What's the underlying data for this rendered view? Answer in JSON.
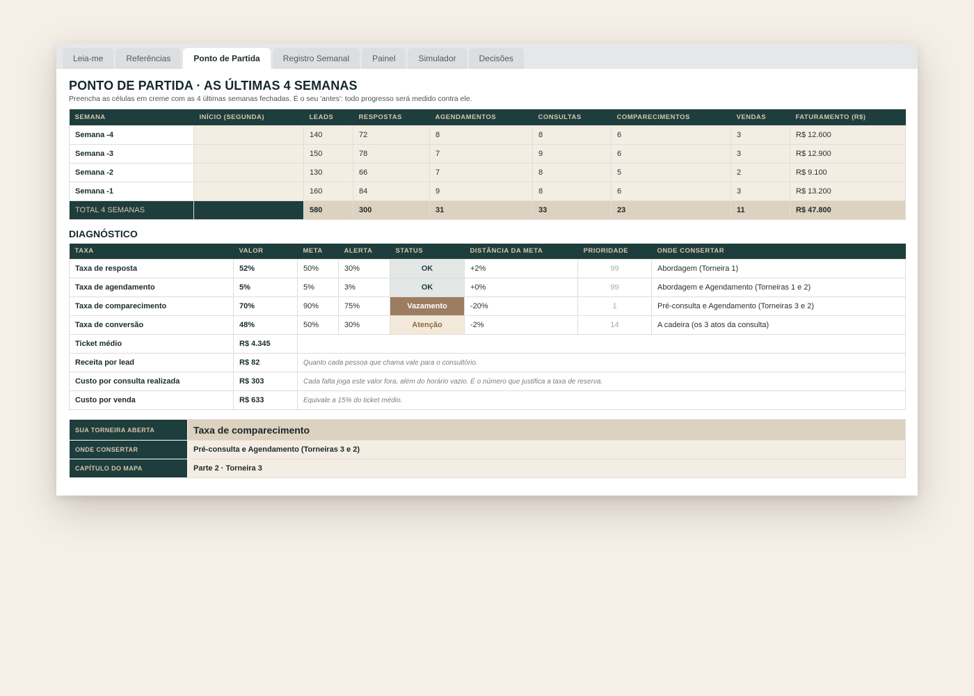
{
  "tabs": [
    {
      "label": "Leia-me",
      "active": false
    },
    {
      "label": "Referências",
      "active": false
    },
    {
      "label": "Ponto de Partida",
      "active": true
    },
    {
      "label": "Registro Semanal",
      "active": false
    },
    {
      "label": "Painel",
      "active": false
    },
    {
      "label": "Simulador",
      "active": false
    },
    {
      "label": "Decisões",
      "active": false
    }
  ],
  "page": {
    "title": "PONTO DE PARTIDA · AS ÚLTIMAS 4 SEMANAS",
    "subtitle": "Preencha as células em creme com as 4 últimas semanas fechadas. É o seu 'antes': todo progresso será medido contra ele."
  },
  "weeks": {
    "headers": [
      "SEMANA",
      "INÍCIO (SEGUNDA)",
      "LEADS",
      "RESPOSTAS",
      "AGENDAMENTOS",
      "CONSULTAS",
      "COMPARECIMENTOS",
      "VENDAS",
      "FATURAMENTO (R$)"
    ],
    "rows": [
      {
        "label": "Semana -4",
        "start": "",
        "leads": "140",
        "respostas": "72",
        "agendamentos": "8",
        "consultas": "8",
        "comparecimentos": "6",
        "vendas": "3",
        "faturamento": "R$ 12.600"
      },
      {
        "label": "Semana -3",
        "start": "",
        "leads": "150",
        "respostas": "78",
        "agendamentos": "7",
        "consultas": "9",
        "comparecimentos": "6",
        "vendas": "3",
        "faturamento": "R$ 12.900"
      },
      {
        "label": "Semana -2",
        "start": "",
        "leads": "130",
        "respostas": "66",
        "agendamentos": "7",
        "consultas": "8",
        "comparecimentos": "5",
        "vendas": "2",
        "faturamento": "R$ 9.100"
      },
      {
        "label": "Semana -1",
        "start": "",
        "leads": "160",
        "respostas": "84",
        "agendamentos": "9",
        "consultas": "8",
        "comparecimentos": "6",
        "vendas": "3",
        "faturamento": "R$ 13.200"
      }
    ],
    "total": {
      "label": "TOTAL 4 SEMANAS",
      "leads": "580",
      "respostas": "300",
      "agendamentos": "31",
      "consultas": "33",
      "comparecimentos": "23",
      "vendas": "11",
      "faturamento": "R$ 47.800"
    }
  },
  "diagnostico": {
    "title": "DIAGNÓSTICO",
    "headers": [
      "TAXA",
      "VALOR",
      "META",
      "ALERTA",
      "STATUS",
      "DISTÂNCIA DA META",
      "PRIORIDADE",
      "ONDE CONSERTAR"
    ],
    "rates": [
      {
        "label": "Taxa de resposta",
        "valor": "52%",
        "meta": "50%",
        "alerta": "30%",
        "status": "OK",
        "status_kind": "ok",
        "distancia": "+2%",
        "prioridade": "99",
        "onde": "Abordagem (Torneira 1)"
      },
      {
        "label": "Taxa de agendamento",
        "valor": "5%",
        "meta": "5%",
        "alerta": "3%",
        "status": "OK",
        "status_kind": "ok",
        "distancia": "+0%",
        "prioridade": "99",
        "onde": "Abordagem e Agendamento (Torneiras 1 e 2)"
      },
      {
        "label": "Taxa de comparecimento",
        "valor": "70%",
        "meta": "90%",
        "alerta": "75%",
        "status": "Vazamento",
        "status_kind": "leak",
        "distancia": "-20%",
        "prioridade": "1",
        "onde": "Pré-consulta e Agendamento (Torneiras 3 e 2)"
      },
      {
        "label": "Taxa de conversão",
        "valor": "48%",
        "meta": "50%",
        "alerta": "30%",
        "status": "Atenção",
        "status_kind": "warn",
        "distancia": "-2%",
        "prioridade": "14",
        "onde": "A cadeira (os 3 atos da consulta)"
      }
    ],
    "metrics": [
      {
        "label": "Ticket médio",
        "valor": "R$ 4.345",
        "note": ""
      },
      {
        "label": "Receita por lead",
        "valor": "R$ 82",
        "note": "Quanto cada pessoa que chama vale para o consultório."
      },
      {
        "label": "Custo por consulta realizada",
        "valor": "R$ 303",
        "note": "Cada falta joga este valor fora, além do horário vazio. É o número que justifica a taxa de reserva."
      },
      {
        "label": "Custo por venda",
        "valor": "R$ 633",
        "note": "Equivale a 15% do ticket médio."
      }
    ]
  },
  "summary": {
    "torneira_label": "SUA TORNEIRA ABERTA",
    "torneira_value": "Taxa de comparecimento",
    "onde_label": "ONDE CONSERTAR",
    "onde_value": "Pré-consulta e Agendamento (Torneiras 3 e 2)",
    "capitulo_label": "CAPÍTULO DO MAPA",
    "capitulo_value": "Parte 2 · Torneira 3"
  },
  "colors": {
    "header_dark": "#1e3d3d",
    "header_text": "#d6c6ad",
    "cream": "#f4ede4",
    "total_beige": "#ddd1bf",
    "leak": "#9c7d62"
  }
}
